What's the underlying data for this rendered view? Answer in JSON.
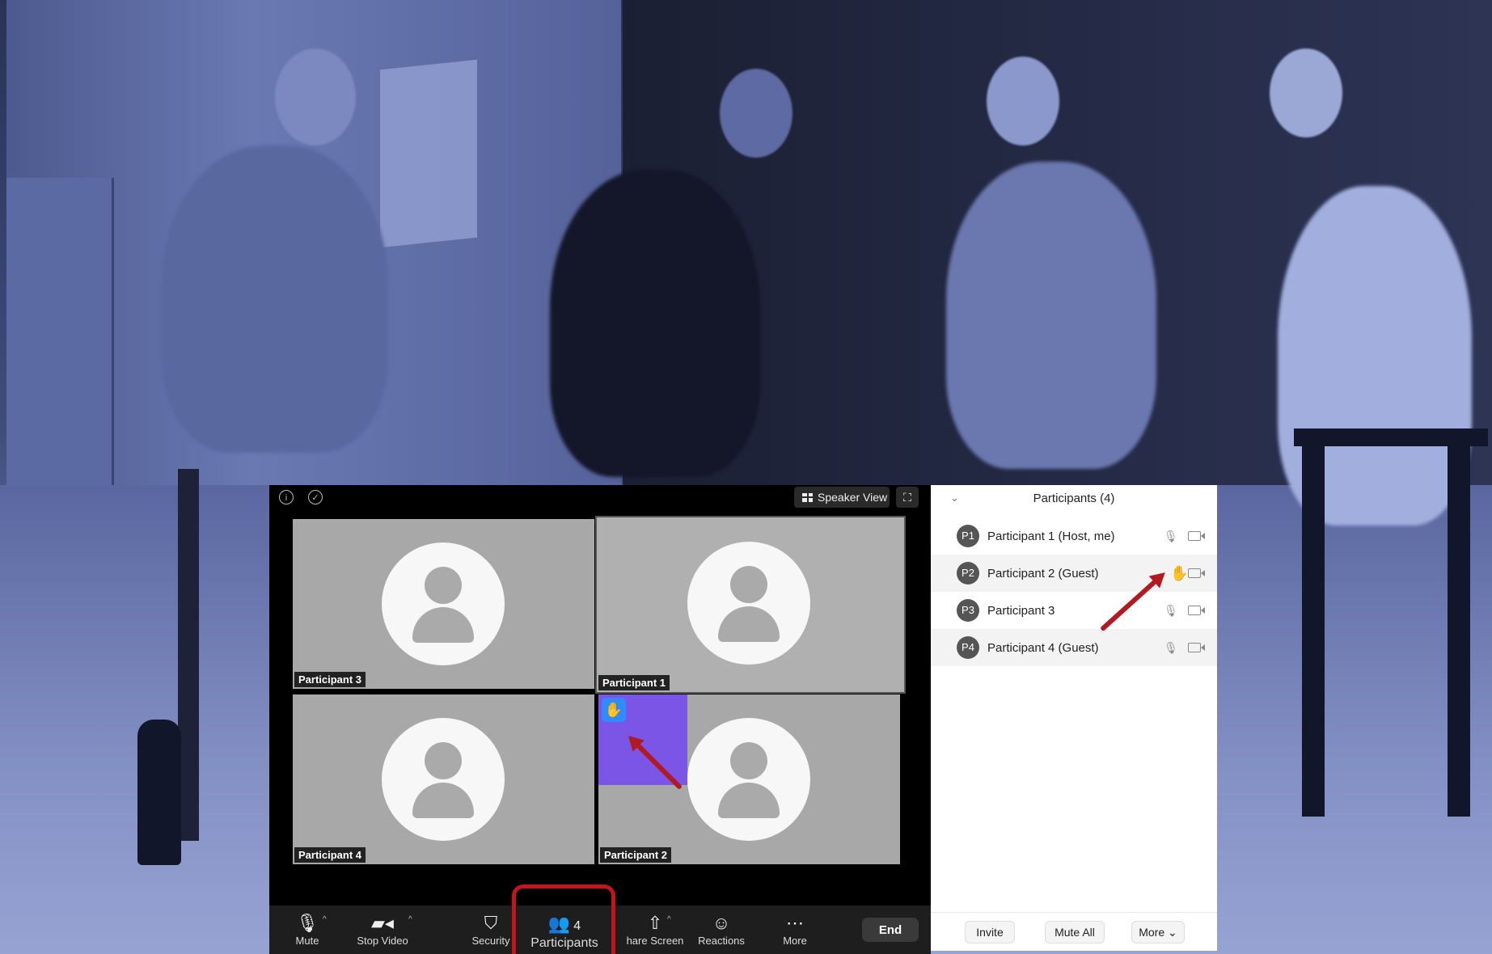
{
  "meeting": {
    "info_icon": "info-icon",
    "security_shield_icon": "shield-check-icon",
    "view_label": "Speaker View",
    "tiles": [
      {
        "name": "Participant 3"
      },
      {
        "name": "Participant 1"
      },
      {
        "name": "Participant 4"
      },
      {
        "name": "Participant 2"
      }
    ],
    "raised_hand_tile": "Participant 2"
  },
  "toolbar": {
    "mute": "Mute",
    "stop_video": "Stop Video",
    "security": "Security",
    "participants": "Participants",
    "participants_count": "4",
    "share_screen": "hare Screen",
    "reactions": "Reactions",
    "more": "More",
    "end": "End"
  },
  "panel": {
    "title": "Participants (4)",
    "participants": [
      {
        "initials": "P1",
        "name": "Participant 1 (Host, me)",
        "hand_raised": false
      },
      {
        "initials": "P2",
        "name": "Participant 2 (Guest)",
        "hand_raised": true
      },
      {
        "initials": "P3",
        "name": "Participant 3",
        "hand_raised": false
      },
      {
        "initials": "P4",
        "name": "Participant 4 (Guest)",
        "hand_raised": false
      }
    ],
    "invite": "Invite",
    "mute_all": "Mute All",
    "more": "More"
  },
  "colors": {
    "raised_hand": "#2e8cff",
    "highlight_tile": "#7b55e6",
    "annotation": "#c4141c"
  }
}
